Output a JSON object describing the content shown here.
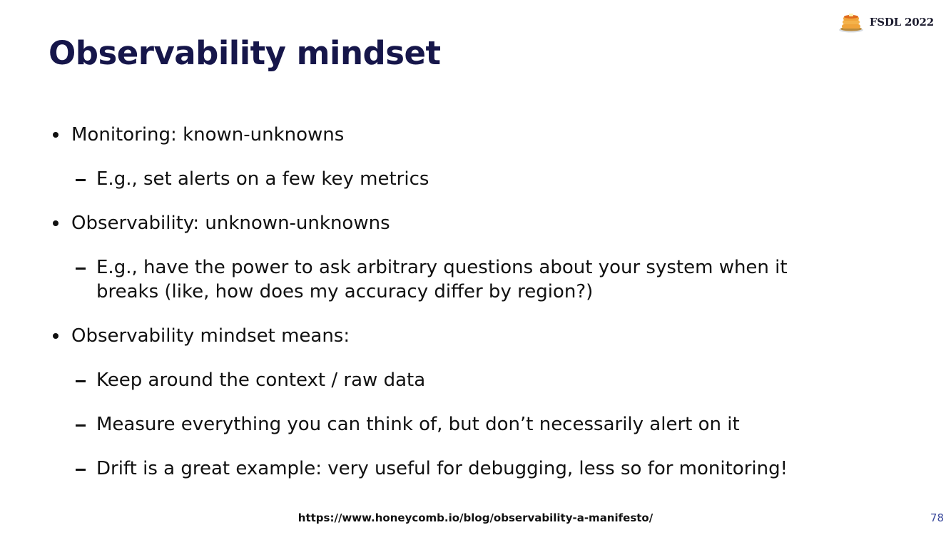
{
  "header": {
    "brand_text": "FSDL 2022",
    "brand_icon": "pancakes-icon"
  },
  "title": "Observability mindset",
  "bullets": [
    {
      "text": "Monitoring: known-unknowns",
      "subs": [
        "E.g., set alerts on a few key metrics"
      ]
    },
    {
      "text": "Observability: unknown-unknowns",
      "subs": [
        "E.g., have the power to ask arbitrary questions about your system when it breaks (like, how does my accuracy differ by region?)"
      ]
    },
    {
      "text": "Observability mindset means:",
      "subs": [
        "Keep around the context / raw data",
        "Measure everything you can think of, but don’t necessarily alert on it",
        "Drift is a great example: very useful for debugging, less so for monitoring!"
      ]
    }
  ],
  "footer": {
    "link": "https://www.honeycomb.io/blog/observability-a-manifesto/",
    "page_number": "78"
  },
  "colors": {
    "title": "#16164a",
    "page_number": "#3b4a9c",
    "pancake": "#f0a43a",
    "syrup": "#e06a1b"
  }
}
